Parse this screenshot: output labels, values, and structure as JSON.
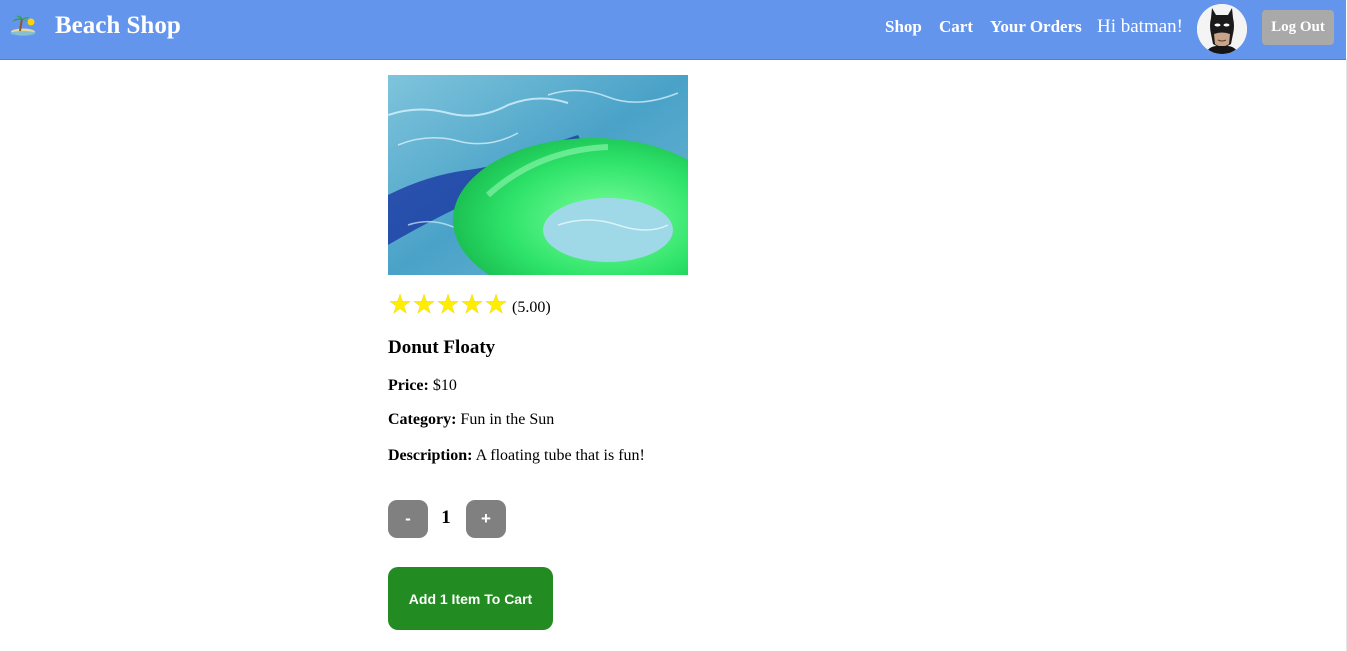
{
  "header": {
    "brand_title": "Beach Shop",
    "brand_icon": "beach-island-icon",
    "nav": {
      "shop": "Shop",
      "cart": "Cart",
      "orders": "Your Orders"
    },
    "greeting": "Hi batman!",
    "avatar": "batman-avatar",
    "logout_label": "Log Out",
    "bg_color": "#6495ed"
  },
  "product": {
    "image": "green-donut-float-in-pool",
    "rating": {
      "stars": 5,
      "max_stars": 5,
      "value_text": "(5.00)",
      "star_color": "#ffee00"
    },
    "name": "Donut Floaty",
    "price_label": "Price:",
    "price_value": "$10",
    "category_label": "Category:",
    "category_value": "Fun in the Sun",
    "description_label": "Description:",
    "description_value": "A floating tube that is fun!"
  },
  "quantity": {
    "decrement_label": "-",
    "value": "1",
    "increment_label": "+"
  },
  "add_to_cart_label": "Add 1 Item To Cart",
  "colors": {
    "add_to_cart_bg": "#228b22",
    "qty_button_bg": "#808080",
    "logout_bg": "#a9a9a9"
  }
}
